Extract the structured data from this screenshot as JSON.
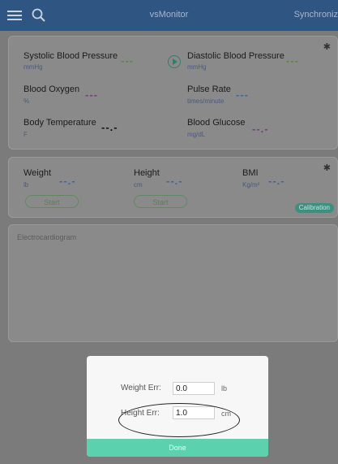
{
  "header": {
    "title": "vsMonitor",
    "right_label": "Synchroniz"
  },
  "vitals": {
    "systolic": {
      "label": "Systolic Blood Pressure",
      "unit": "mmHg",
      "value": "---"
    },
    "diastolic": {
      "label": "Diastolic Blood Pressure",
      "unit": "mmHg",
      "value": "---"
    },
    "oxygen": {
      "label": "Blood Oxygen",
      "unit": "%",
      "value": "---"
    },
    "pulse": {
      "label": "Pulse Rate",
      "unit": "times/minute",
      "value": "---"
    },
    "temperature": {
      "label": "Body Temperature",
      "unit": "F",
      "value": "--.-"
    },
    "glucose": {
      "label": "Blood Glucose",
      "unit": "mg/dL",
      "value": "--.-"
    }
  },
  "body": {
    "weight": {
      "label": "Weight",
      "unit": "lb",
      "value": "--.-",
      "button": "Start"
    },
    "height": {
      "label": "Height",
      "unit": "cm",
      "value": "--.-",
      "button": "Start"
    },
    "bmi": {
      "label": "BMI",
      "unit": "Kg/m²",
      "value": "--.-"
    },
    "calibration_label": "Calibration"
  },
  "ecg": {
    "title": "Electrocardiogram"
  },
  "dialog": {
    "weight_err_label": "Weight Err:",
    "weight_err_value": "0.0",
    "weight_err_unit": "lb",
    "height_err_label": "Height Err:",
    "height_err_value": "1.0",
    "height_err_unit": "cm",
    "done_label": "Done"
  },
  "colors": {
    "header": "#2f5582",
    "accent": "#5bd1ae",
    "calibration": "#3e8f80"
  },
  "icons": {
    "menu": "menu-icon",
    "search": "search-icon",
    "play": "play-icon",
    "bluetooth": "bluetooth-icon"
  }
}
